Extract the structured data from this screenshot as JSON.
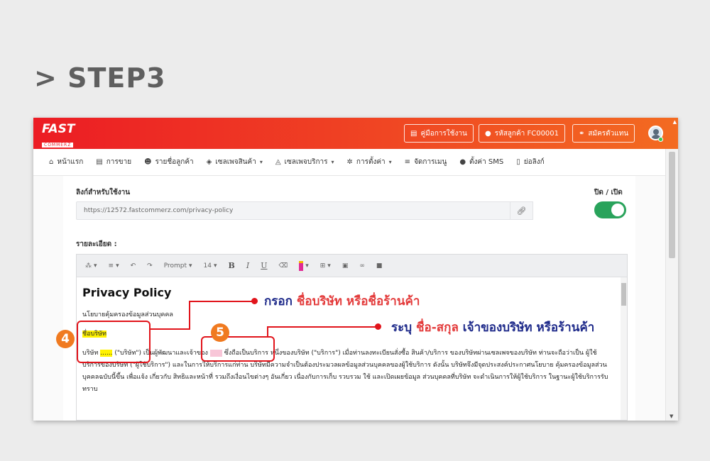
{
  "step_title": "> STEP3",
  "logo": {
    "line1": "FAST",
    "line2": "COMMERZ"
  },
  "topbar": {
    "manual": "คู่มือการใช้งาน",
    "customer_code": "รหัสลูกค้า FC00001",
    "agent": "สมัครตัวแทน"
  },
  "nav": {
    "home": "หน้าแรก",
    "sales": "การขาย",
    "customers": "รายชื่อลูกค้า",
    "product_page": "เซลเพจสินค้า",
    "service_page": "เซลเพจบริการ",
    "settings": "การตั้งค่า",
    "menu": "จัดการเมนู",
    "sms": "ตั้งค่า SMS",
    "shortlink": "ย่อลิงก์"
  },
  "form": {
    "link_label": "ลิงก์สำหรับใช้งาน",
    "toggle_label": "ปิด / เปิด",
    "url_value": "https://12572.fastcommerz.com/privacy-policy",
    "toggle_on": true,
    "detail_label": "รายละเอียด :"
  },
  "toolbar": {
    "font": "Prompt",
    "size": "14",
    "bold": "B",
    "italic": "I",
    "underline": "U"
  },
  "editor": {
    "title": "Privacy Policy",
    "subtitle": "นโยบายคุ้มครองข้อมูลส่วนบุคคล",
    "company_placeholder": "ชื่อบริษัท",
    "p_start": "บริษัท ",
    "p_blank1": "......",
    "p_mid1": " (\"บริษัท\") เป็นผู้พัฒนาและเจ้าของ ",
    "p_blank2": "......",
    "p_rest": " ซึ่งถือเป็นบริการ หนึ่งของบริษัท (\"บริการ\") เมื่อท่านลงทะเบียนสั่งซื้อ สินค้า/บริการ ของบริษัทผ่านเซลเพจของบริษัท ท่านจะถือว่าเป็น ผู้ใช้บริการของบริษัท (\"ผู้ใช้บริการ\") และในการให้บริการแก่ท่าน บริษัทมีความจำเป็นต้องประมวลผลข้อมูลส่วนบุคคลของผู้ใช้บริการ ดังนั้น บริษัทจึงมีจุดประสงค์ประกาศนโยบาย คุ้มครองข้อมูลส่วนบุคคลฉบับนี้ขึ้น เพื่อแจ้ง เกี่ยวกับ สิทธิและหน้าที่ รวมถึงเงื่อนไขต่างๆ อันเกี่ยว เนื่องกับการเก็บ รวบรวม ใช้ และเปิดเผยข้อมูล ส่วนบุคคลที่บริษัท จะดำเนินการให้ผู้ใช้บริการ ในฐานะผู้ใช้บริการรับทราบ"
  },
  "annotations": {
    "badge4": "4",
    "badge5": "5",
    "callout4_a": "กรอก ",
    "callout4_b": "ชื่อบริษัท หรือชื่อร้านค้า",
    "callout5_a": "ระบุ ",
    "callout5_b": "ชื่อ-สกุล",
    "callout5_c": " เจ้าของบริษัท หรือร้านค้า"
  }
}
